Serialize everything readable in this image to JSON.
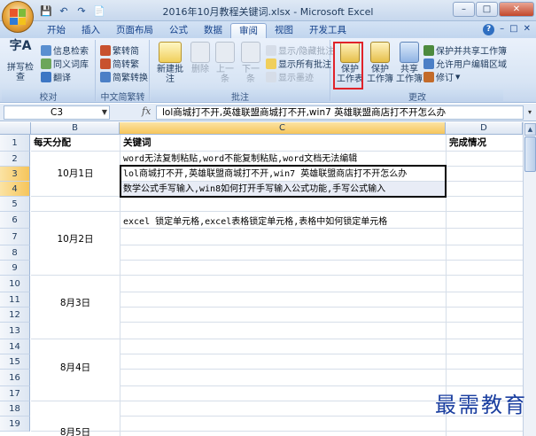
{
  "window": {
    "title": "2016年10月教程关键词.xlsx - Microsoft Excel",
    "minimize": "–",
    "maximize": "□",
    "close": "✕"
  },
  "qat": [
    "💾",
    "↶",
    "↷",
    "📄"
  ],
  "tabs": [
    "开始",
    "插入",
    "页面布局",
    "公式",
    "数据",
    "审阅",
    "视图",
    "开发工具"
  ],
  "active_tab": "审阅",
  "tabrow_right": {
    "help": "?",
    "min": "–",
    "restore": "□",
    "close": "✕"
  },
  "ribbon": {
    "proofing": {
      "label": "校对",
      "spell": "拼写检查",
      "research": "信息检索",
      "thesaurus": "同义词库",
      "translate": "翻译"
    },
    "chinese": {
      "label": "中文简繁转换",
      "to_trad": "繁转简",
      "to_simp": "简转繁",
      "convert": "简繁转换"
    },
    "comments": {
      "label": "批注",
      "new": "新建批注",
      "delete": "删除",
      "prev": "上一条",
      "next": "下一条",
      "show_hide": "显示/隐藏批注",
      "show_all": "显示所有批注",
      "show_ink": "显示墨迹"
    },
    "changes": {
      "label": "更改",
      "protect_sheet_l1": "保护",
      "protect_sheet_l2": "工作表",
      "protect_wb_l1": "保护",
      "protect_wb_l2": "工作簿",
      "share_l1": "共享",
      "share_l2": "工作簿",
      "protect_share": "保护并共享工作簿",
      "allow_edit": "允许用户编辑区域",
      "track": "修订"
    }
  },
  "formula_bar": {
    "name_box": "C3",
    "fx": "fx",
    "content": "lol商城打不开,英雄联盟商城打不开,win7 英雄联盟商店打不开怎么办"
  },
  "columns": [
    "B",
    "C",
    "D"
  ],
  "rows": [
    "1",
    "2",
    "3",
    "4",
    "5",
    "6",
    "7",
    "8",
    "9",
    "10",
    "11",
    "12",
    "13",
    "14",
    "15",
    "16",
    "17",
    "18",
    "19"
  ],
  "cells": {
    "B1": "每天分配",
    "C1": "关键词",
    "D1": "完成情况",
    "B2": "10月1日",
    "C2": "word无法复制粘贴,word不能复制粘贴,word文档无法编辑",
    "C3": "lol商城打不开,英雄联盟商城打不开,win7 英雄联盟商店打不开怎么办",
    "C4": "数学公式手写输入,win8如何打开手写输入公式功能,手写公式输入",
    "C6": "excel 锁定单元格,excel表格锁定单元格,表格中如何锁定单元格",
    "B6": "10月2日",
    "B10": "8月3日",
    "B14": "8月4日",
    "B18": "8月5日"
  },
  "watermark": "最需教育"
}
